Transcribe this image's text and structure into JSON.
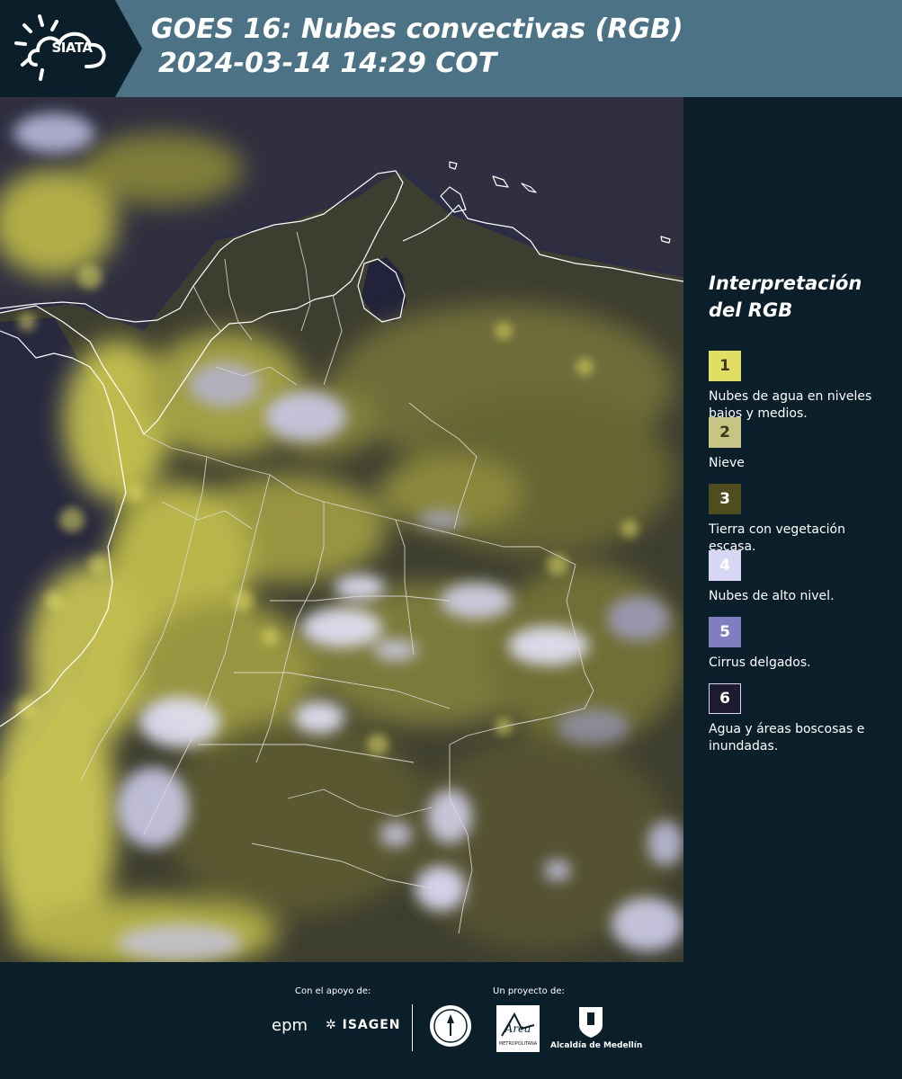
{
  "header": {
    "logo_text": "SIATA",
    "title_line1": "GOES 16: Nubes convectivas (RGB)",
    "title_line2": "2024-03-14 14:29 COT",
    "background_color": "#4b7285"
  },
  "legend": {
    "title_line1": "Interpretación",
    "title_line2": "del RGB",
    "items": [
      {
        "number": "1",
        "label": "Nubes de agua en niveles bajos y medios.",
        "color": "#e1df63",
        "text_color": "#3a3a20"
      },
      {
        "number": "2",
        "label": "Nieve",
        "color": "#c7c583",
        "text_color": "#3a3a20"
      },
      {
        "number": "3",
        "label": "Tierra con vegetación escasa.",
        "color": "#4f4d1f",
        "text_color": "#ffffff"
      },
      {
        "number": "4",
        "label": "Nubes de alto nivel.",
        "color": "#d9d8f4",
        "text_color": "#ffffff"
      },
      {
        "number": "5",
        "label": "Cirrus delgados.",
        "color": "#7f7fbf",
        "text_color": "#ffffff"
      },
      {
        "number": "6",
        "label": "Agua y áreas boscosas e inundadas.",
        "color": "#1c1c2e",
        "text_color": "#ffffff"
      }
    ]
  },
  "footer": {
    "support_label": "Con el apoyo de:",
    "project_label": "Un proyecto de:",
    "epm": "epm",
    "isagen": "ISAGEN",
    "area_text": "Área",
    "area_subtext": "METROPOLITANA",
    "alcaldia": "Alcaldía de Medellín"
  }
}
